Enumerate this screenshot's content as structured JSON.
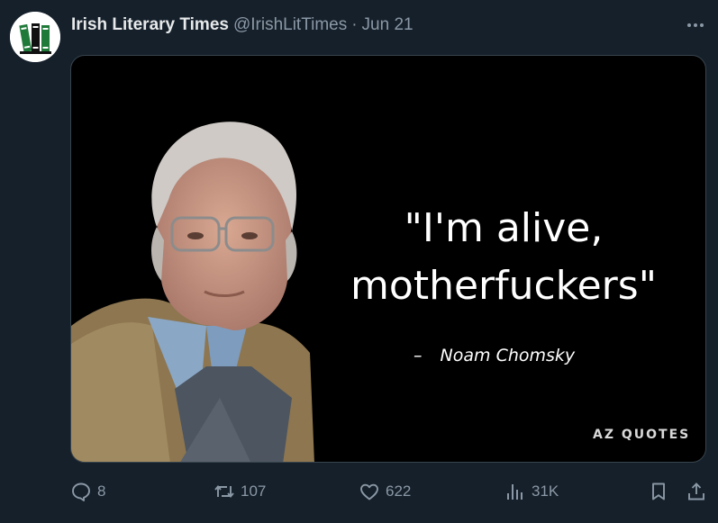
{
  "tweet": {
    "display_name": "Irish Literary Times",
    "handle": "@IrishLitTimes",
    "separator": "·",
    "date": "Jun 21"
  },
  "media": {
    "quote_lines": [
      "\"I'm alive,",
      "motherfuckers\""
    ],
    "attribution_dash": "–",
    "attribution_name": "Noam Chomsky",
    "watermark": "AZ QUOTES"
  },
  "actions": {
    "replies": "8",
    "retweets": "107",
    "likes": "622",
    "views": "31K"
  },
  "icons": {
    "more": "more-horizontal-icon",
    "reply": "reply-icon",
    "retweet": "retweet-icon",
    "like": "heart-icon",
    "views": "views-icon",
    "bookmark": "bookmark-icon",
    "share": "share-icon"
  },
  "colors": {
    "background": "#15202b",
    "primary_text": "#e7e9ea",
    "secondary_text": "#8b98a5",
    "border": "#38444d"
  }
}
